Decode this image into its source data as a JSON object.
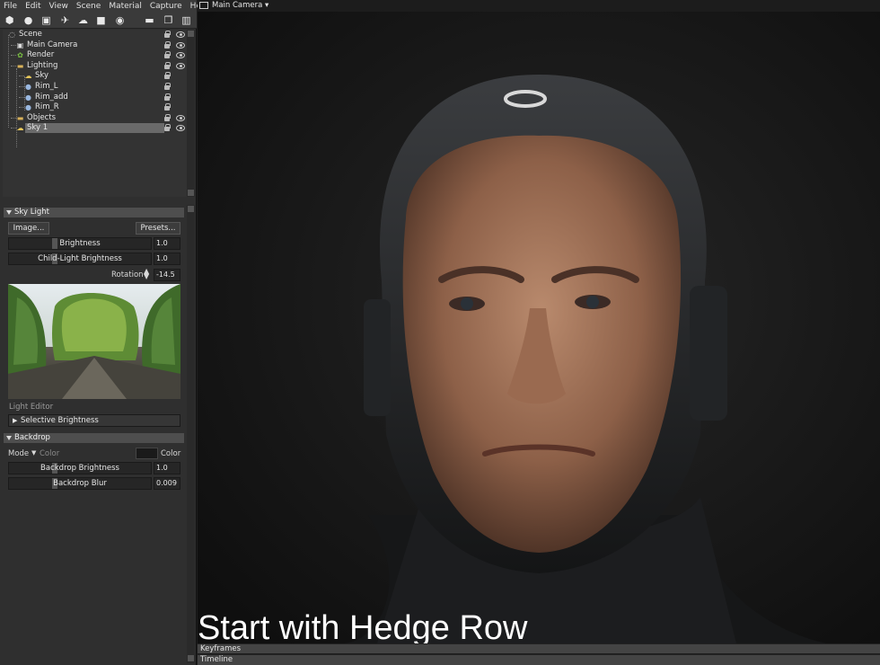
{
  "menu": [
    "File",
    "Edit",
    "View",
    "Scene",
    "Material",
    "Capture",
    "Help"
  ],
  "toolbar_icons": [
    "cube-icon",
    "bulb-icon",
    "camera-icon",
    "plane-icon",
    "cloud-icon",
    "box-icon",
    "ball-icon",
    "folder-icon",
    "duplicate-icon",
    "trash-icon"
  ],
  "scene_tree": [
    {
      "label": "Scene",
      "icon": "scene-icon",
      "indent": 0,
      "eye": true
    },
    {
      "label": "Main Camera",
      "icon": "camera-icon",
      "indent": 1,
      "eye": true
    },
    {
      "label": "Render",
      "icon": "render-icon",
      "indent": 1,
      "eye": true
    },
    {
      "label": "Lighting",
      "icon": "folder-icon",
      "indent": 1,
      "eye": true
    },
    {
      "label": "Sky",
      "icon": "sky-icon",
      "indent": 2,
      "eye": false
    },
    {
      "label": "Rim_L",
      "icon": "light-icon",
      "indent": 2,
      "eye": false
    },
    {
      "label": "Rim_add",
      "icon": "light-icon",
      "indent": 2,
      "eye": false
    },
    {
      "label": "Rim_R",
      "icon": "light-icon",
      "indent": 2,
      "eye": false
    },
    {
      "label": "Objects",
      "icon": "folder-icon",
      "indent": 1,
      "eye": true
    },
    {
      "label": "Sky 1",
      "icon": "sky-icon",
      "indent": 1,
      "eye": true,
      "selected": true
    }
  ],
  "sky_light": {
    "title": "Sky Light",
    "image_button": "Image...",
    "presets_button": "Presets...",
    "brightness_label": "Brightness",
    "brightness_value": "1.0",
    "child_brightness_label": "Child-Light Brightness",
    "child_brightness_value": "1.0",
    "rotation_label": "Rotation",
    "rotation_value": "-14.5",
    "light_editor_label": "Light Editor",
    "selective_brightness_label": "Selective Brightness"
  },
  "backdrop": {
    "title": "Backdrop",
    "mode_label": "Mode",
    "mode_value": "Color",
    "color_label": "Color",
    "color_swatch": "#1a1a1a",
    "brightness_label": "Backdrop Brightness",
    "brightness_value": "1.0",
    "blur_label": "Backdrop Blur",
    "blur_value": "0.009"
  },
  "viewport": {
    "camera_label": "Main Camera",
    "caption": "Start with Hedge Row"
  },
  "bottom": {
    "keyframes_label": "Keyframes",
    "timeline_label": "Timeline"
  }
}
